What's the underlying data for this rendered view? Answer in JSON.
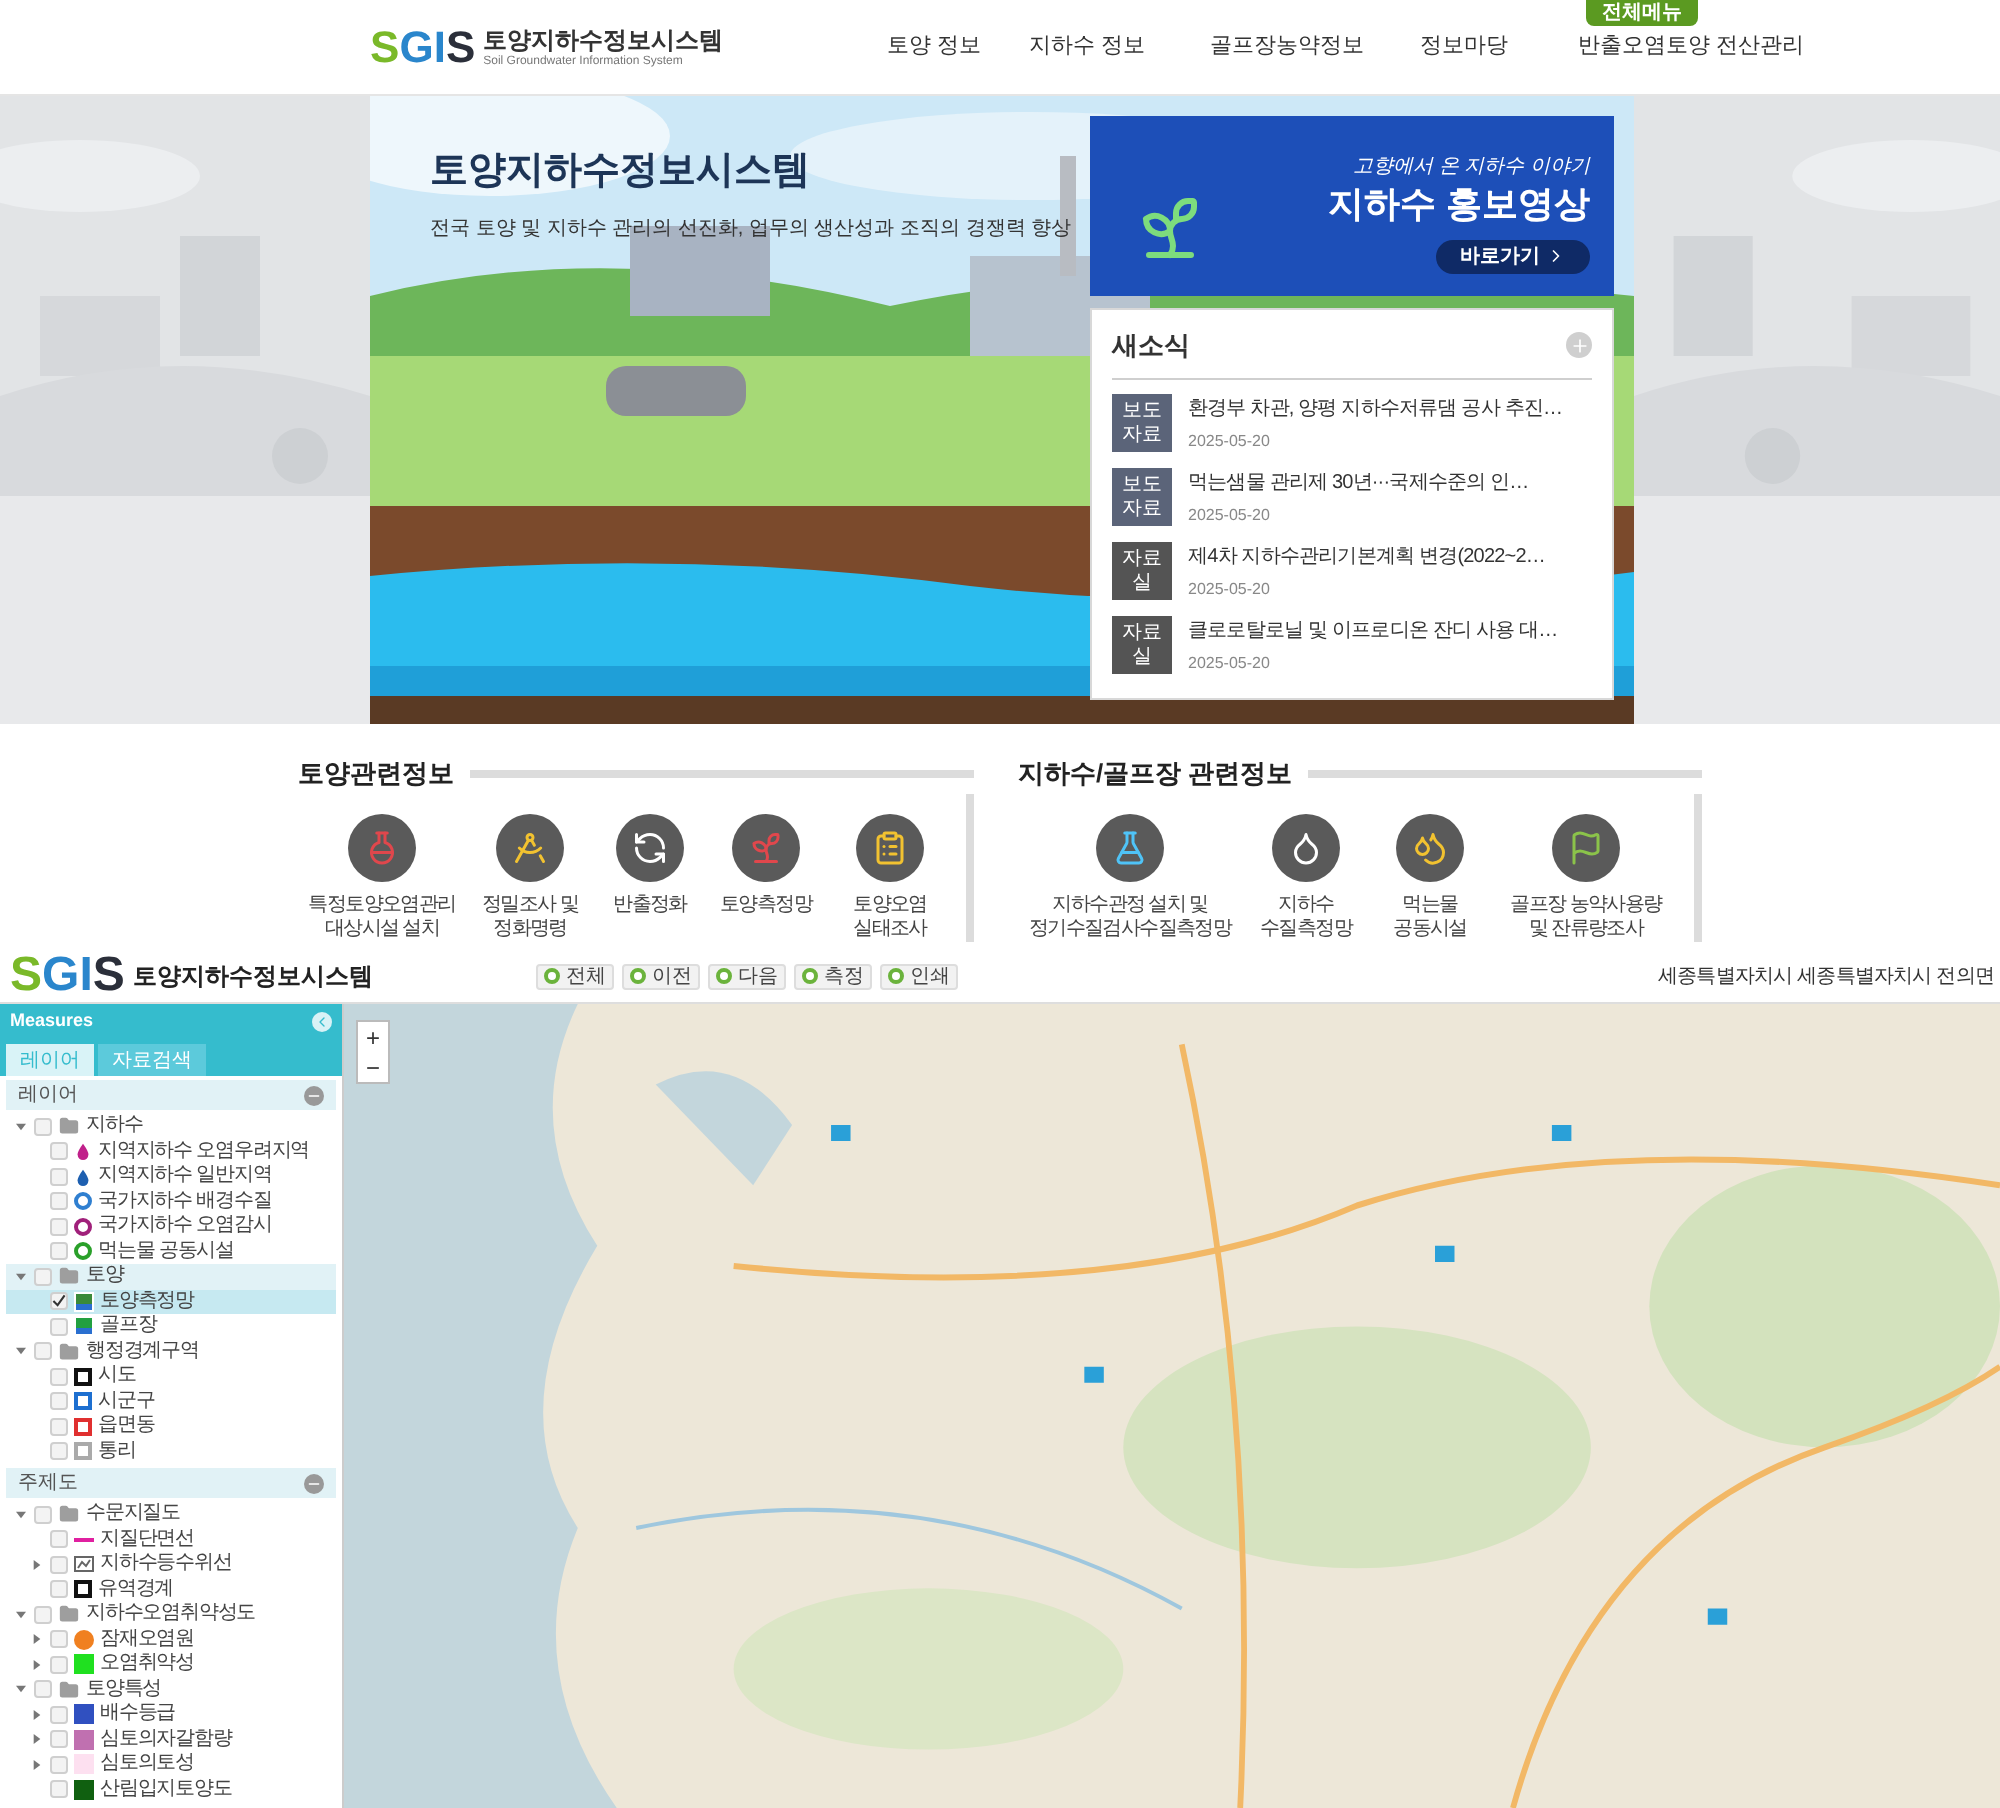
{
  "site": {
    "logo_letters": [
      {
        "text": "S",
        "color": "#7ab929"
      },
      {
        "text": "G",
        "color": "#2a86cc"
      },
      {
        "text": "I",
        "color": "#2a86cc"
      },
      {
        "text": "S",
        "color": "#2b2f3a"
      }
    ],
    "title": "토양지하수정보시스템",
    "subtitle": "Soil Groundwater Information System",
    "menu_button": "전체메뉴",
    "nav": [
      "토양 정보",
      "지하수 정보",
      "골프장농약정보",
      "정보마당",
      "반출오염토양 전산관리"
    ]
  },
  "hero": {
    "title": "토양지하수정보시스템",
    "subtitle": "전국 토양 및 지하수 관리의 선진화, 업무의 생산성과 조직의 경쟁력 향상",
    "promo": {
      "caption": "고향에서 온 지하수 이야기",
      "title": "지하수 홍보영상",
      "button": "바로가기"
    },
    "news": {
      "title": "새소식",
      "items": [
        {
          "tag": "보도자료",
          "color": "#5b6479",
          "title": "환경부 차관, 양평 지하수저류댐 공사 추진…",
          "date": "2025-05-20"
        },
        {
          "tag": "보도자료",
          "color": "#5b6479",
          "title": "먹는샘물 관리제 30년···국제수준의 인…",
          "date": "2025-05-20"
        },
        {
          "tag": "자료실",
          "color": "#545454",
          "title": "제4차 지하수관리기본계획 변경(2022~2…",
          "date": "2025-05-20"
        },
        {
          "tag": "자료실",
          "color": "#545454",
          "title": "클로로탈로닐 및 이프로디온 잔디 사용 대…",
          "date": "2025-05-20"
        }
      ]
    }
  },
  "info": {
    "groups": [
      {
        "title": "토양관련정보",
        "items": [
          {
            "label": "특정토양오염관리\n대상시설 설치"
          },
          {
            "label": "정밀조사 및\n정화명령"
          },
          {
            "label": "반출정화"
          },
          {
            "label": "토양측정망"
          },
          {
            "label": "토양오염\n실태조사"
          }
        ]
      },
      {
        "title": "지하수/골프장 관련정보",
        "items": [
          {
            "label": "지하수관정 설치 및\n정기수질검사수질측정망"
          },
          {
            "label": "지하수\n수질측정망"
          },
          {
            "label": "먹는물\n공동시설"
          },
          {
            "label": "골프장 농약사용량\n및 잔류량조사"
          }
        ]
      }
    ]
  },
  "map_app": {
    "logo_letters": [
      {
        "text": "S",
        "color": "#7ab929"
      },
      {
        "text": "G",
        "color": "#2a86cc"
      },
      {
        "text": "I",
        "color": "#2a86cc"
      },
      {
        "text": "S",
        "color": "#2b2f3a"
      }
    ],
    "title": "토양지하수정보시스템",
    "tools": [
      "전체",
      "이전",
      "다음",
      "측정",
      "인쇄"
    ],
    "location": "세종특별자치시 세종특별자치시 전의면",
    "zoom": [
      "+",
      "−"
    ],
    "sidebar": {
      "title": "Measures",
      "tabs": [
        {
          "label": "레이어",
          "selected": true
        },
        {
          "label": "자료검색",
          "selected": false
        }
      ],
      "sections": [
        {
          "title": "레이어",
          "items": [
            {
              "label": "지하수",
              "kind": "folder",
              "expanded": true,
              "checked": false,
              "selected": false,
              "children": [
                {
                  "label": "지역지하수 오염우려지역",
                  "kind": "drop",
                  "color": "#c0208a",
                  "checked": false,
                  "selected": false
                },
                {
                  "label": "지역지하수 일반지역",
                  "kind": "drop",
                  "color": "#1d5fb0",
                  "checked": false,
                  "selected": false
                },
                {
                  "label": "국가지하수 배경수질",
                  "kind": "ring",
                  "color": "#2f7fd0",
                  "checked": false,
                  "selected": false
                },
                {
                  "label": "국가지하수 오염감시",
                  "kind": "ring",
                  "color": "#a0207a",
                  "checked": false,
                  "selected": false
                },
                {
                  "label": "먹는물 공동시설",
                  "kind": "ring",
                  "color": "#2aa02a",
                  "checked": false,
                  "selected": false
                }
              ]
            },
            {
              "label": "토양",
              "kind": "folder",
              "expanded": true,
              "checked": false,
              "selected": true,
              "children": [
                {
                  "label": "토양측정망",
                  "kind": "map",
                  "color": "#3a8a3a",
                  "checked": true,
                  "selected": true
                },
                {
                  "label": "골프장",
                  "kind": "map",
                  "color": "#22a040",
                  "checked": false,
                  "selected": false
                }
              ]
            },
            {
              "label": "행정경계구역",
              "kind": "folder",
              "expanded": true,
              "checked": false,
              "selected": false,
              "children": [
                {
                  "label": "시도",
                  "kind": "outline",
                  "color": "#111111",
                  "checked": false,
                  "selected": false
                },
                {
                  "label": "시군구",
                  "kind": "outline",
                  "color": "#1d6fd0",
                  "checked": false,
                  "selected": false
                },
                {
                  "label": "읍면동",
                  "kind": "outline",
                  "color": "#e03030",
                  "checked": false,
                  "selected": false
                },
                {
                  "label": "통리",
                  "kind": "outline",
                  "color": "#aaaaaa",
                  "checked": false,
                  "selected": false
                }
              ]
            }
          ]
        },
        {
          "title": "주제도",
          "items": [
            {
              "label": "수문지질도",
              "kind": "folder",
              "expanded": true,
              "checked": false,
              "selected": false,
              "children": [
                {
                  "label": "지질단면선",
                  "kind": "line",
                  "color": "#e020a0",
                  "checked": false,
                  "selected": false
                },
                {
                  "label": "지하수등수위선",
                  "kind": "grid",
                  "expanded": false,
                  "checked": false,
                  "selected": false
                },
                {
                  "label": "유역경계",
                  "kind": "outline",
                  "color": "#111111",
                  "checked": false,
                  "selected": false
                }
              ]
            },
            {
              "label": "지하수오염취약성도",
              "kind": "folder",
              "expanded": true,
              "checked": false,
              "selected": false,
              "children": [
                {
                  "label": "잠재오염원",
                  "kind": "dot",
                  "color": "#f08020",
                  "expanded": false,
                  "checked": false,
                  "selected": false
                },
                {
                  "label": "오염취약성",
                  "kind": "fill",
                  "color": "#20e020",
                  "expanded": false,
                  "checked": false,
                  "selected": false
                }
              ]
            },
            {
              "label": "토양특성",
              "kind": "folder",
              "expanded": true,
              "checked": false,
              "selected": false,
              "children": [
                {
                  "label": "배수등급",
                  "kind": "fill",
                  "color": "#3050c0",
                  "expanded": false,
                  "checked": false,
                  "selected": false
                },
                {
                  "label": "심토의자갈함량",
                  "kind": "fill",
                  "color": "#c070b0",
                  "expanded": false,
                  "checked": false,
                  "selected": false
                },
                {
                  "label": "심토의토성",
                  "kind": "fill",
                  "color": "#fde0f0",
                  "expanded": false,
                  "checked": false,
                  "selected": false
                },
                {
                  "label": "산림입지토양도",
                  "kind": "fill",
                  "color": "#106010",
                  "checked": false,
                  "selected": false
                }
              ]
            }
          ]
        }
      ]
    }
  }
}
